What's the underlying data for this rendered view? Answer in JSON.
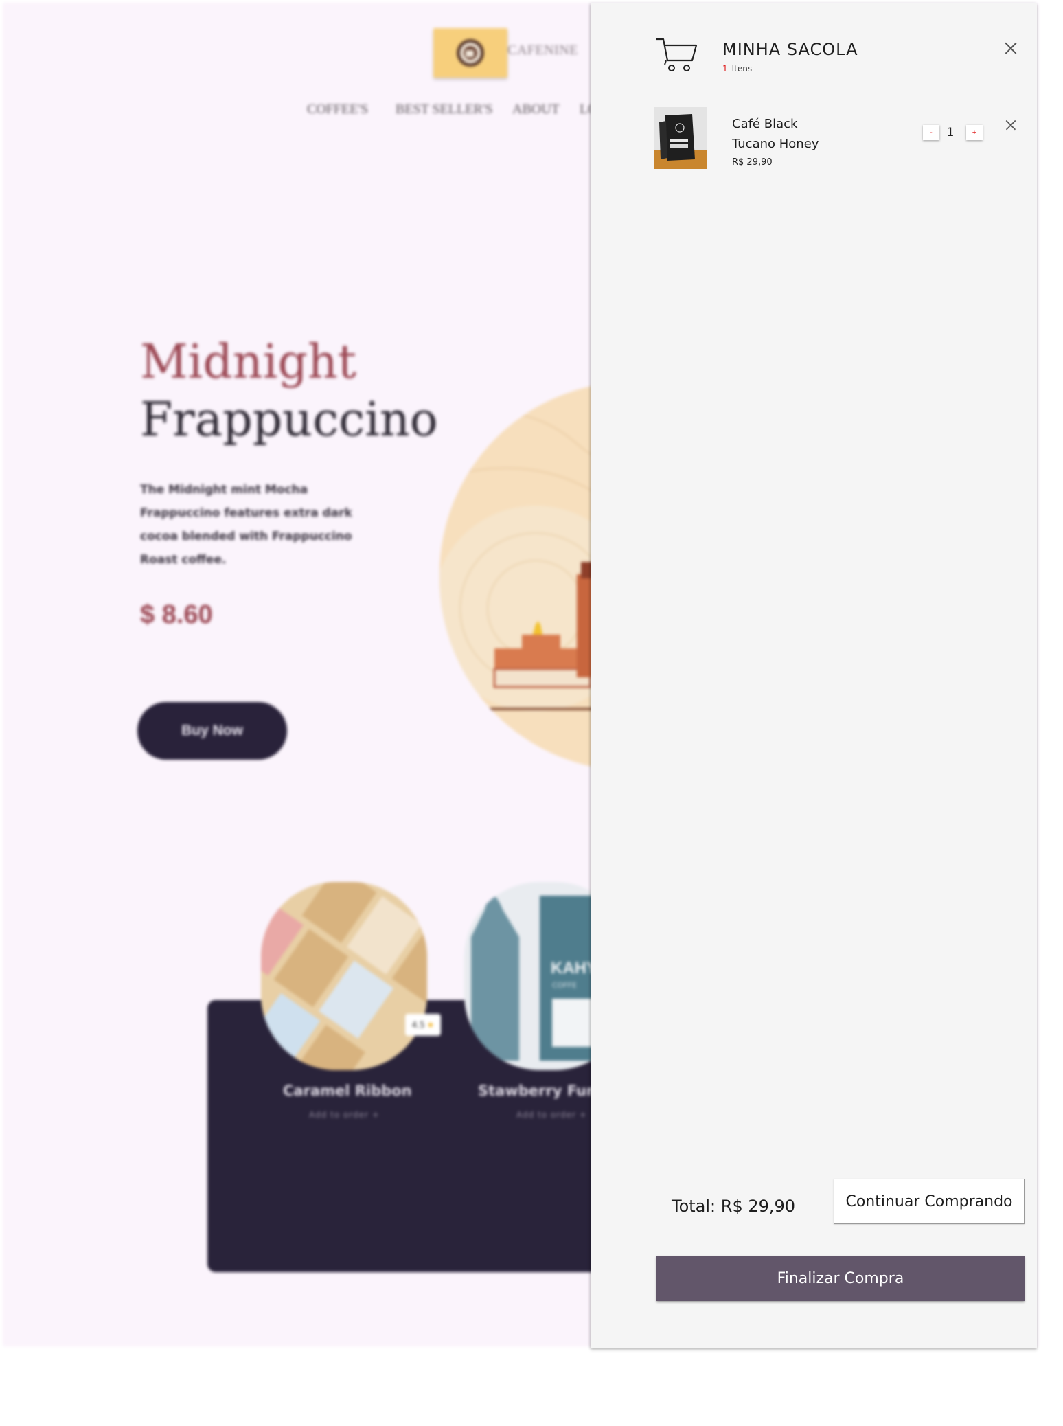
{
  "site": {
    "brand": "CAFENINE",
    "nav": [
      "COFFEE'S",
      "BEST SELLER'S",
      "ABOUT",
      "LO"
    ],
    "hero": {
      "title_line1": "Midnight",
      "title_line2": "Frappuccino",
      "description": "The Midnight mint Mocha Frappuccino features extra dark cocoa blended with Frappuccino Roast coffee.",
      "price": "$  8.60",
      "buy_label": "Buy  Now"
    },
    "products": [
      {
        "name": "Caramel  Ribbon",
        "sub": "Add  to  order  +",
        "rating": "4.5"
      },
      {
        "name": "Stawberry  Funn",
        "sub": "Add  to  order  +",
        "brand_text": "KAHY",
        "brand_sub": "COFFE"
      }
    ]
  },
  "cart": {
    "title": "MINHA SACOLA",
    "count": "1",
    "count_label": "Itens",
    "items": [
      {
        "name_line1": "Café Black",
        "name_line2": "Tucano Honey",
        "price": "R$ 29,90",
        "quantity": "1",
        "minus_label": "-",
        "plus_label": "+"
      }
    ],
    "total": "Total: R$ 29,90",
    "continue_label": "Continuar Comprando",
    "checkout_label": "Finalizar Compra"
  },
  "colors": {
    "accent_red": "#9b4652",
    "dark_navy": "#29223a",
    "checkout": "#62566a",
    "drawer_bg": "#f5f5f5",
    "count_red": "#e02020"
  },
  "icons": [
    "coffee-cup-logo-icon",
    "shopping-cart-icon",
    "close-icon",
    "star-icon"
  ]
}
